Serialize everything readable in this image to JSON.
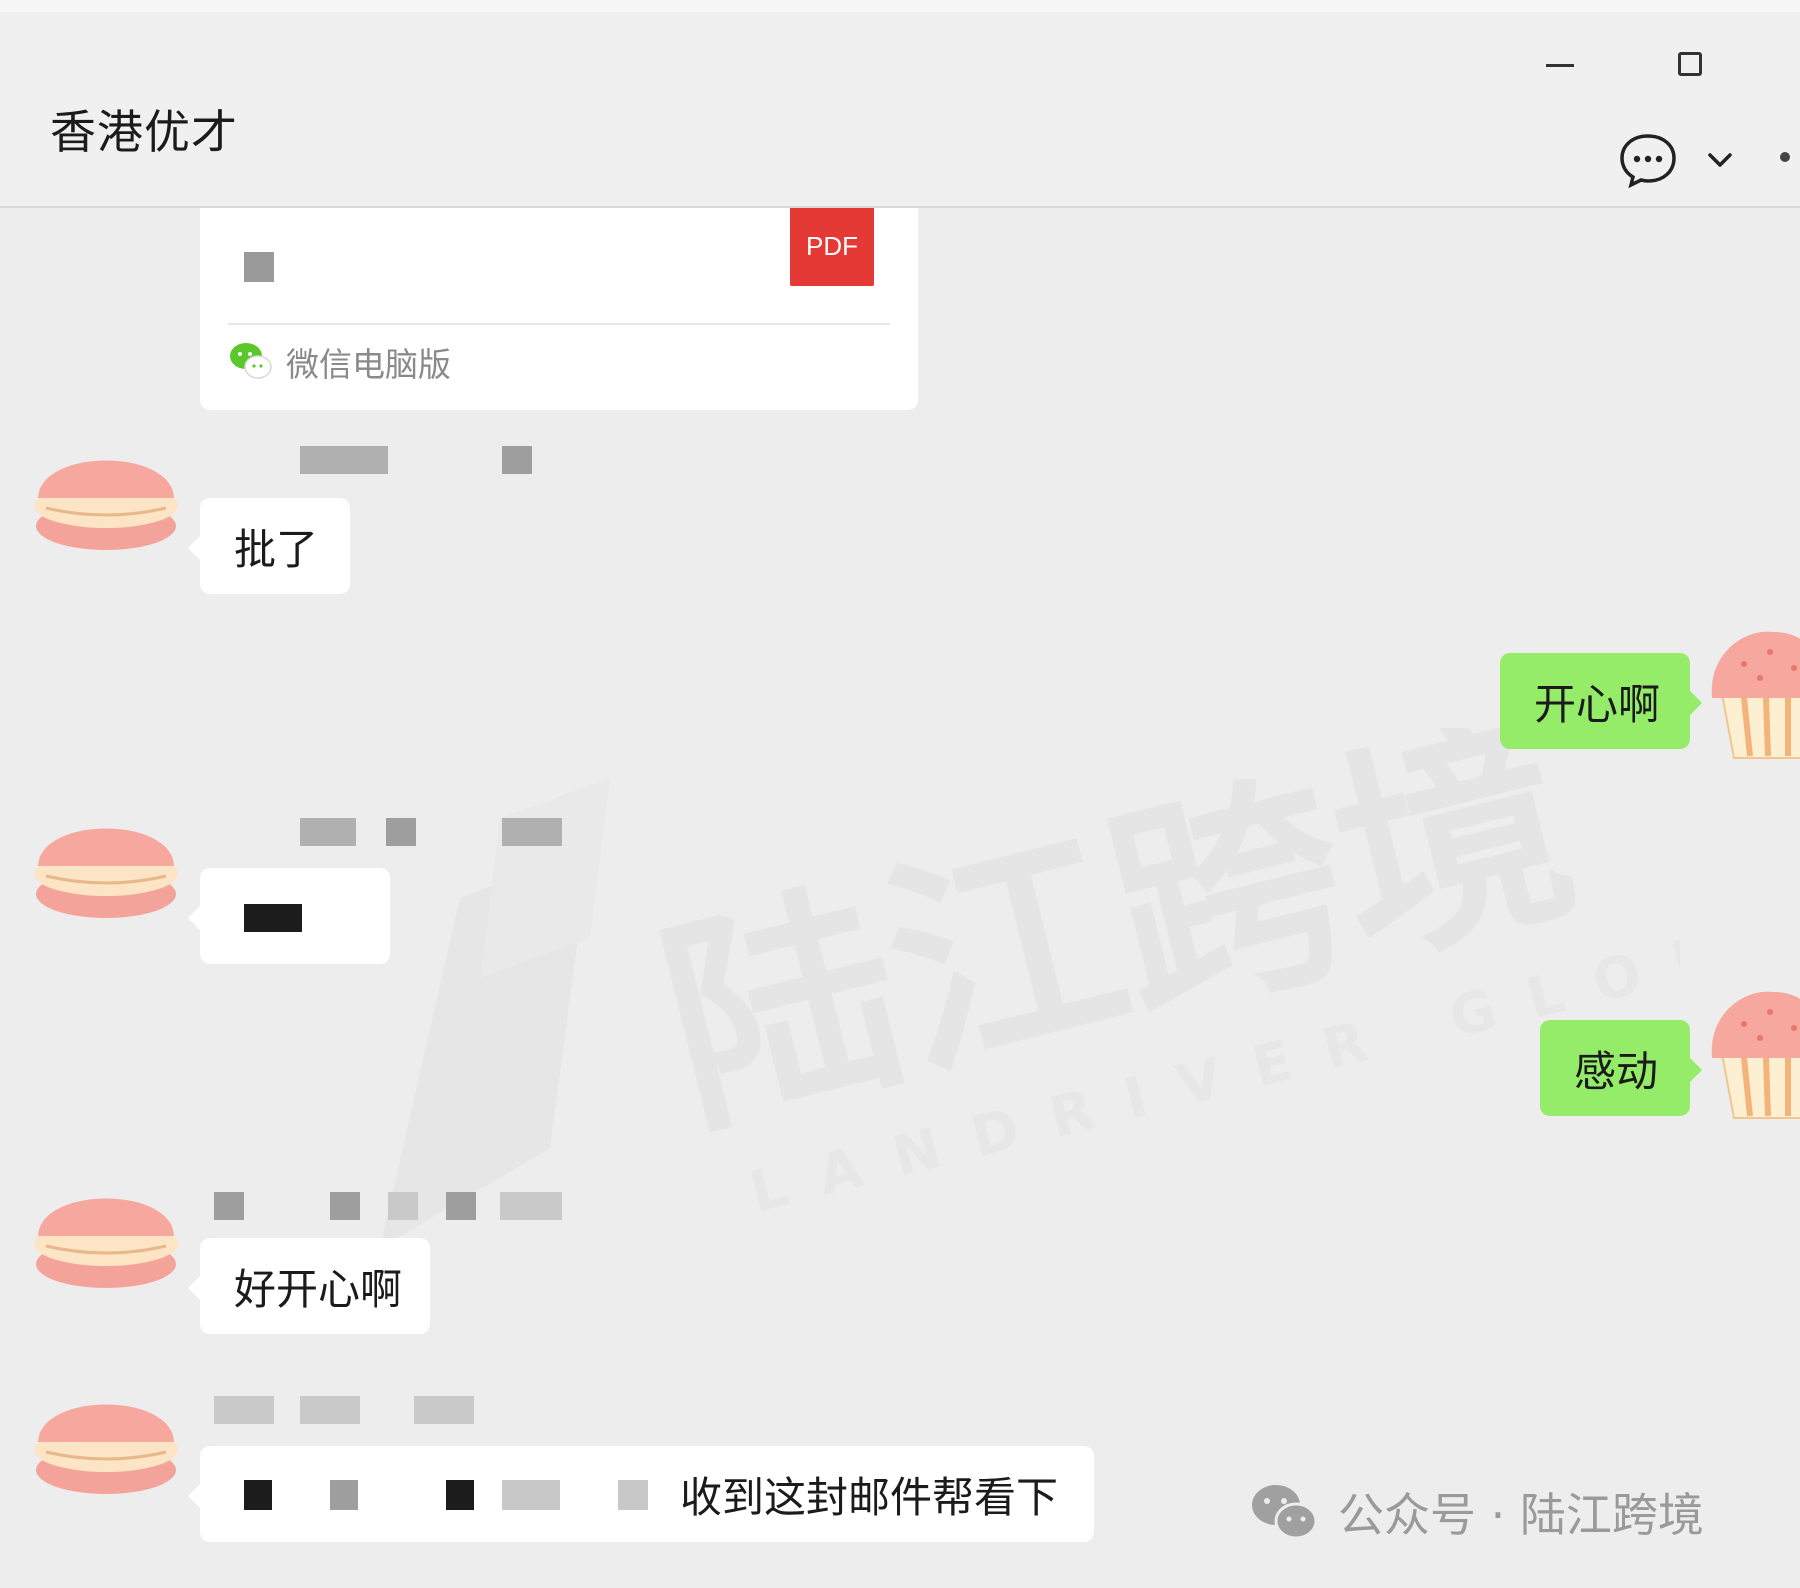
{
  "window": {
    "title": "香港优才"
  },
  "toolbar": {
    "icons": [
      "minimize-icon",
      "maximize-icon",
      "chat-bubble-icon",
      "chevron-down-icon"
    ]
  },
  "file_card": {
    "badge": "PDF",
    "source": "微信电脑版"
  },
  "messages": [
    {
      "side": "left",
      "text": "批了"
    },
    {
      "side": "right",
      "text": "开心啊"
    },
    {
      "side": "left",
      "text": ""
    },
    {
      "side": "right",
      "text": "感动"
    },
    {
      "side": "left",
      "text": "好开心啊"
    },
    {
      "side": "left",
      "text": "收到这封邮件帮看下"
    }
  ],
  "footer_watermark": {
    "text": "公众号 · 陆江跨境"
  },
  "background_watermark": {
    "cn": "陆江跨境",
    "en": "LANDRIVER GLOBAL"
  },
  "colors": {
    "my_bubble": "#95ec69",
    "pdf_badge": "#e53935",
    "background": "#ededed"
  }
}
